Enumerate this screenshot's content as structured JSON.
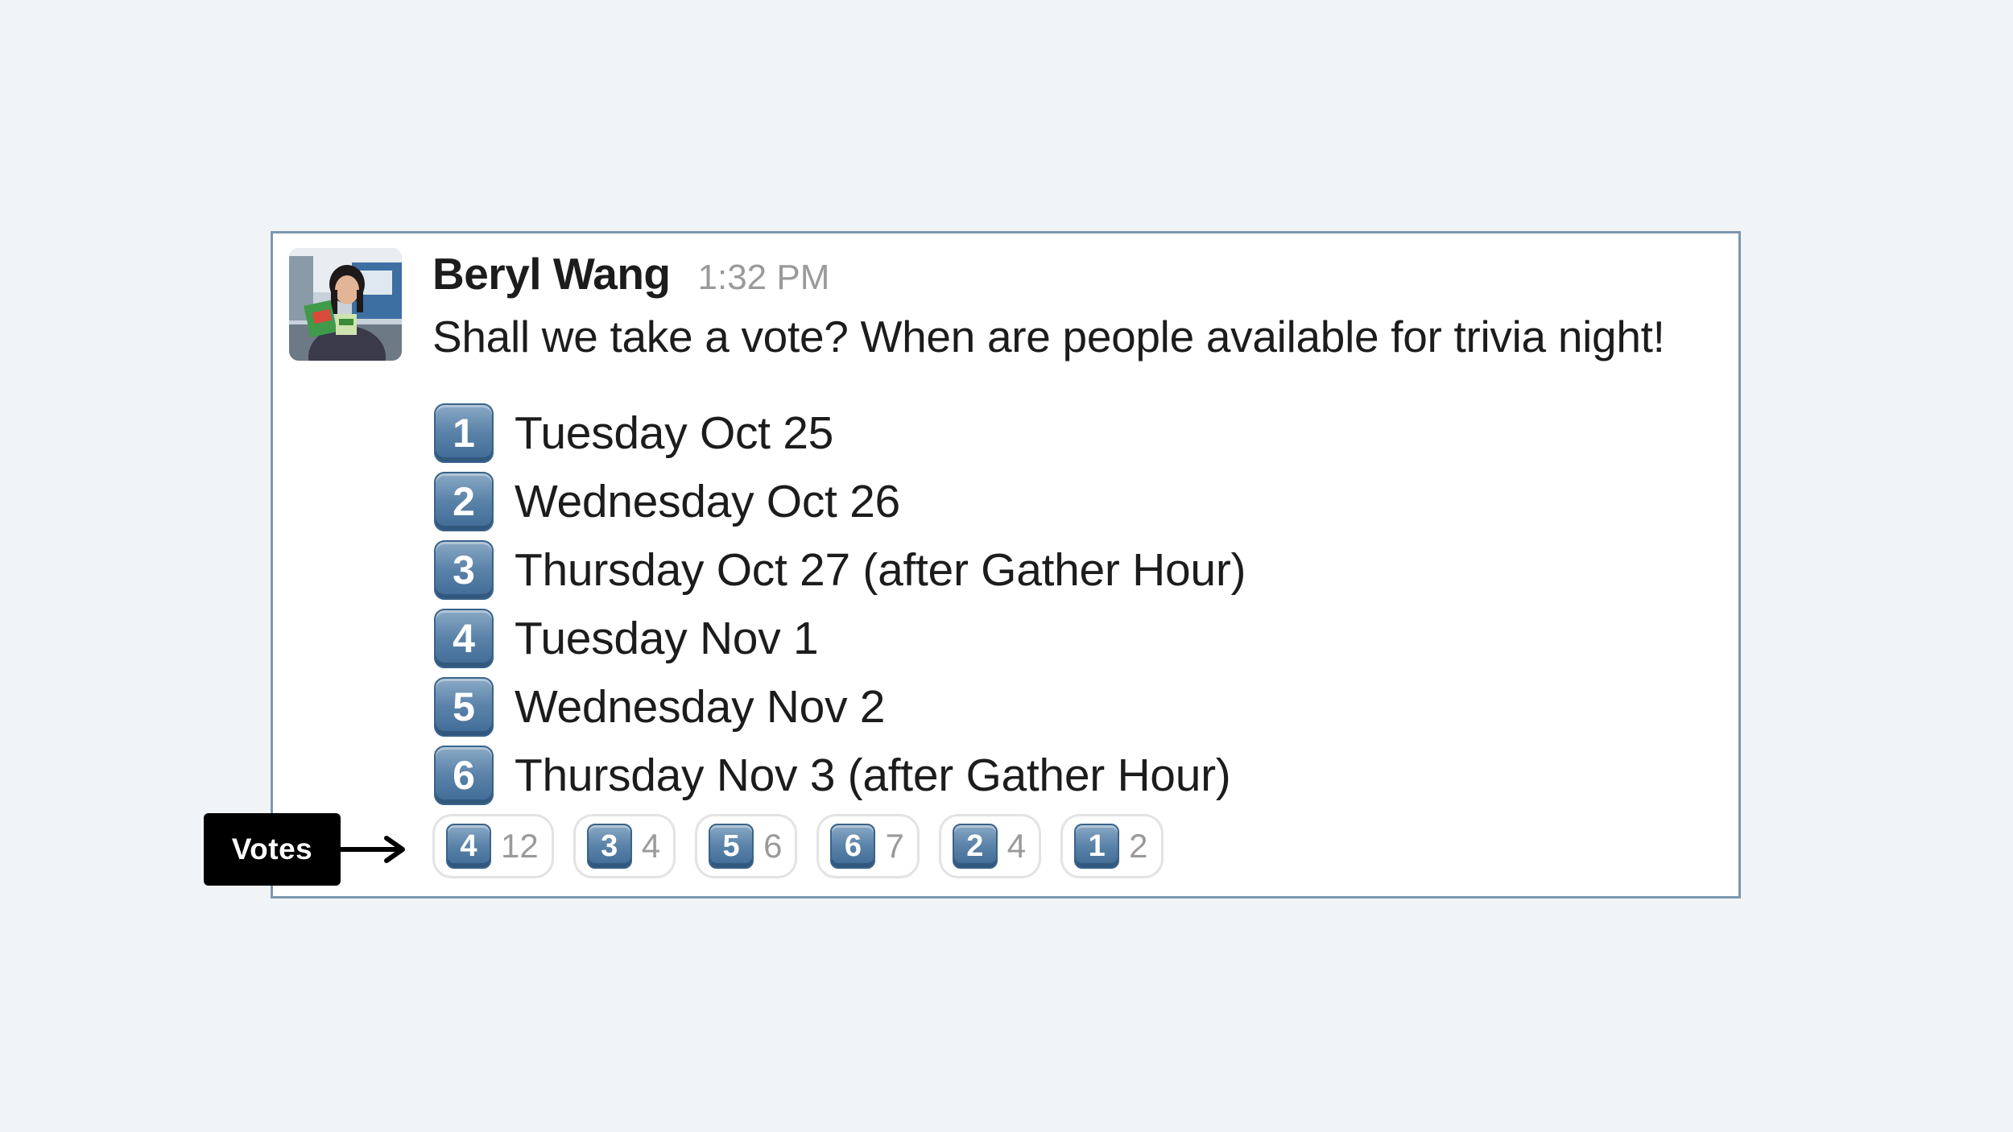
{
  "message": {
    "author": "Beryl Wang",
    "timestamp": "1:32 PM",
    "text": "Shall we take a vote? When are people available for trivia night!",
    "options": [
      {
        "number": "1",
        "label": "Tuesday Oct 25"
      },
      {
        "number": "2",
        "label": "Wednesday Oct 26"
      },
      {
        "number": "3",
        "label": "Thursday Oct 27 (after Gather Hour)"
      },
      {
        "number": "4",
        "label": "Tuesday Nov 1"
      },
      {
        "number": "5",
        "label": "Wednesday Nov 2"
      },
      {
        "number": "6",
        "label": "Thursday Nov 3 (after Gather Hour)"
      }
    ],
    "reactions": [
      {
        "emoji": "4",
        "count": "12"
      },
      {
        "emoji": "3",
        "count": "4"
      },
      {
        "emoji": "5",
        "count": "6"
      },
      {
        "emoji": "6",
        "count": "7"
      },
      {
        "emoji": "2",
        "count": "4"
      },
      {
        "emoji": "1",
        "count": "2"
      }
    ]
  },
  "annotation": {
    "label": "Votes"
  },
  "colors": {
    "background": "#f1f4f7",
    "card_border": "#7d97ae",
    "keycap_blue": "#5b83a9",
    "annotation_bg": "#000000"
  },
  "icons": {
    "keycap": "number-keycap-emoji-icon",
    "arrow": "right-arrow-icon"
  }
}
